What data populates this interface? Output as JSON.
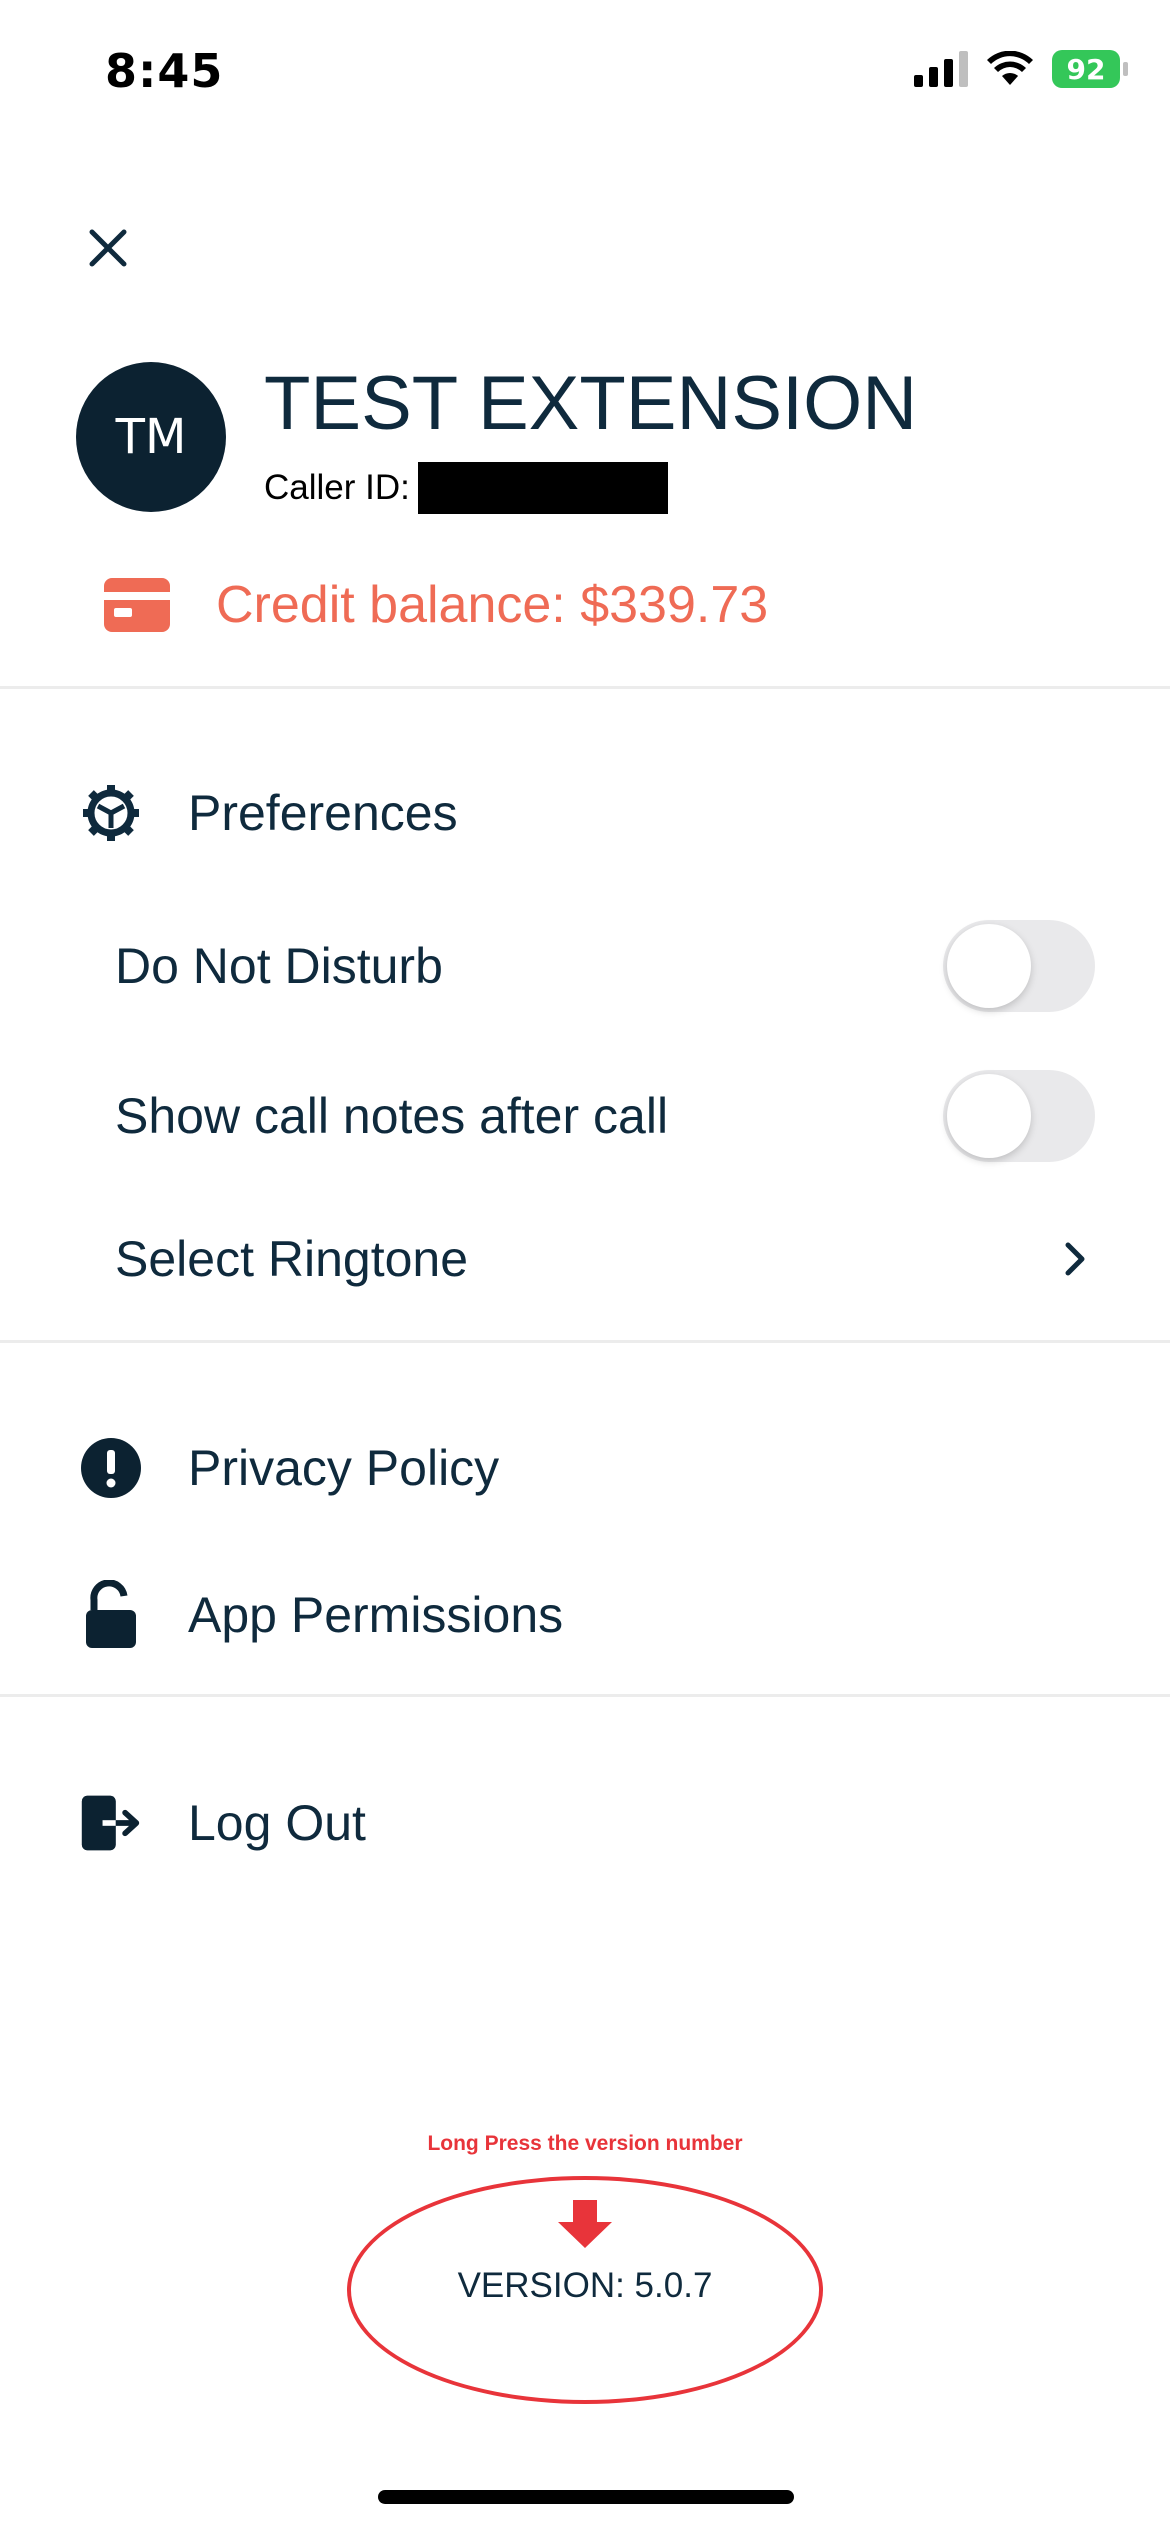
{
  "status": {
    "time": "8:45",
    "battery": "92"
  },
  "profile": {
    "initials": "TM",
    "name": "TEST EXTENSION",
    "caller_id_label": "Caller ID:"
  },
  "credit": {
    "label": "Credit balance: $339.73"
  },
  "menu": {
    "preferences": "Preferences",
    "do_not_disturb": "Do Not Disturb",
    "do_not_disturb_on": false,
    "show_call_notes": "Show call notes after call",
    "show_call_notes_on": false,
    "select_ringtone": "Select Ringtone",
    "privacy_policy": "Privacy Policy",
    "app_permissions": "App Permissions",
    "log_out": "Log Out"
  },
  "footer": {
    "hint": "Long Press the version number",
    "version": "VERSION: 5.0.7"
  },
  "colors": {
    "accent": "#ef6b55",
    "navy": "#0c2231",
    "annotation": "#e8343a",
    "battery": "#34c759"
  },
  "icons": [
    "close-icon",
    "credit-card-icon",
    "gear-icon",
    "chevron-right-icon",
    "alert-circle-icon",
    "unlock-icon",
    "logout-icon",
    "arrow-down-icon"
  ]
}
